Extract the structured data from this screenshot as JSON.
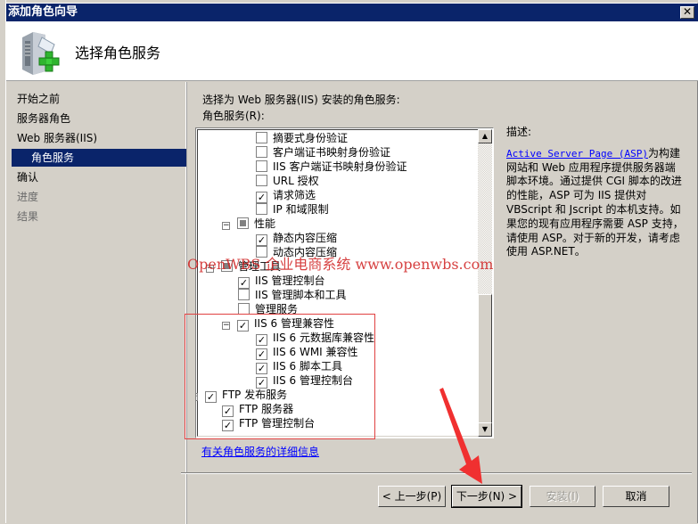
{
  "window": {
    "title": "添加角色向导",
    "close_icon": "close-icon"
  },
  "header": {
    "title": "选择角色服务",
    "icon": "server-add-icon"
  },
  "sidebar": {
    "items": [
      {
        "label": "开始之前",
        "state": "normal"
      },
      {
        "label": "服务器角色",
        "state": "normal"
      },
      {
        "label": "Web 服务器(IIS)",
        "state": "normal"
      },
      {
        "label": "角色服务",
        "state": "selected"
      },
      {
        "label": "确认",
        "state": "normal"
      },
      {
        "label": "进度",
        "state": "disabled"
      },
      {
        "label": "结果",
        "state": "disabled"
      }
    ]
  },
  "main": {
    "instruction": "选择为 Web 服务器(IIS) 安装的角色服务:",
    "list_label": "角色服务(R):",
    "tree": [
      {
        "label": "摘要式身份验证",
        "checked": false,
        "level": 3
      },
      {
        "label": "客户端证书映射身份验证",
        "checked": false,
        "level": 3
      },
      {
        "label": "IIS 客户端证书映射身份验证",
        "checked": false,
        "level": 3
      },
      {
        "label": "URL 授权",
        "checked": false,
        "level": 3
      },
      {
        "label": "请求筛选",
        "checked": true,
        "level": 3
      },
      {
        "label": "IP 和域限制",
        "checked": false,
        "level": 3
      },
      {
        "label": "性能",
        "checked": "partial",
        "level": 2,
        "expanded": true
      },
      {
        "label": "静态内容压缩",
        "checked": true,
        "level": 3
      },
      {
        "label": "动态内容压缩",
        "checked": false,
        "level": 3
      },
      {
        "label": "管理工具",
        "checked": "partial",
        "level": 1,
        "expanded": true
      },
      {
        "label": "IIS 管理控制台",
        "checked": true,
        "level": 2
      },
      {
        "label": "IIS 管理脚本和工具",
        "checked": false,
        "level": 2
      },
      {
        "label": "管理服务",
        "checked": false,
        "level": 2
      },
      {
        "label": "IIS 6 管理兼容性",
        "checked": true,
        "level": 2,
        "expanded": true
      },
      {
        "label": "IIS 6 元数据库兼容性",
        "checked": true,
        "level": 3
      },
      {
        "label": "IIS 6 WMI 兼容性",
        "checked": true,
        "level": 3
      },
      {
        "label": "IIS 6 脚本工具",
        "checked": true,
        "level": 3
      },
      {
        "label": "IIS 6 管理控制台",
        "checked": true,
        "level": 3
      },
      {
        "label": "FTP 发布服务",
        "checked": true,
        "level": 0,
        "expanded": true
      },
      {
        "label": "FTP 服务器",
        "checked": true,
        "level": 1
      },
      {
        "label": "FTP 管理控制台",
        "checked": true,
        "level": 1
      }
    ],
    "more_info_link": "有关角色服务的详细信息"
  },
  "description": {
    "label": "描述:",
    "link": "Active Server Page (ASP)",
    "text": "为构建网站和 Web 应用程序提供服务器端脚本环境。通过提供 CGI 脚本的改进的性能，ASP 可为 IIS 提供对 VBScript 和 Jscript 的本机支持。如果您的现有应用程序需要 ASP 支持，请使用 ASP。对于新的开发，请考虑使用 ASP.NET。"
  },
  "buttons": {
    "back": "< 上一步(P)",
    "next": "下一步(N) >",
    "install": "安装(I)",
    "cancel": "取消"
  },
  "overlay": {
    "watermark": "OpenWBS 企业电商系统 www.openwbs.com",
    "annotation_color": "#e04040"
  },
  "colors": {
    "titlebar": "#0a246a",
    "selection": "#0a246a",
    "face": "#d4d0c8",
    "link": "#0000ff"
  }
}
